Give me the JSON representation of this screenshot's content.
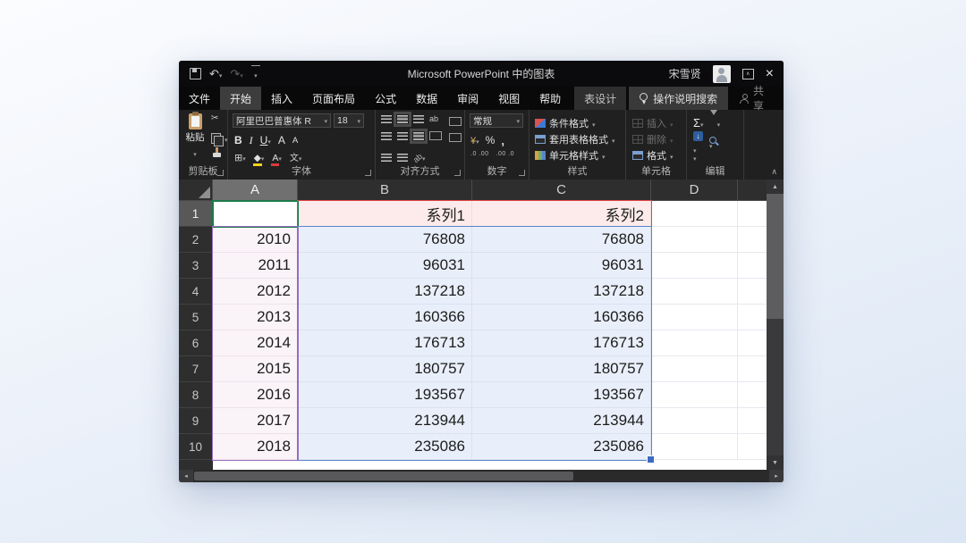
{
  "window": {
    "title": "Microsoft PowerPoint 中的图表",
    "user_name": "宋雪贤",
    "tabs": [
      "文件",
      "开始",
      "插入",
      "页面布局",
      "公式",
      "数据",
      "审阅",
      "视图",
      "帮助",
      "表设计"
    ],
    "active_tab": "开始",
    "search_label": "操作说明搜索",
    "share_label": "共享"
  },
  "icons": {
    "undo": "↶",
    "redo": "↷",
    "close": "×",
    "restore": "∧",
    "scissors": "✂",
    "borders": "⊞",
    "fill_arrow": "↓"
  },
  "ribbon": {
    "groups": {
      "clipboard": "剪贴板",
      "font": "字体",
      "alignment": "对齐方式",
      "number": "数字",
      "styles": "样式",
      "cells": "单元格",
      "editing": "编辑"
    },
    "clipboard": {
      "paste": "粘贴"
    },
    "font": {
      "name": "阿里巴巴普惠体 R",
      "size": "18",
      "bold": "B",
      "italic": "I",
      "underline": "U",
      "grow": "A",
      "shrink": "A",
      "phonetic": "文"
    },
    "alignment": {
      "orientation": "ab",
      "direction": "ab"
    },
    "number": {
      "format": "常规",
      "currency": "¥",
      "percent": "%",
      "comma": ",",
      "inc_decimal": ".0 .00",
      "dec_decimal": ".00 .0"
    },
    "styles": {
      "conditional": "条件格式",
      "format_table": "套用表格格式",
      "cell_styles": "单元格样式"
    },
    "cells": {
      "insert": "插入",
      "delete": "删除",
      "format": "格式"
    },
    "editing": {
      "autosum": "Σ"
    }
  },
  "sheet": {
    "col_headers": [
      "A",
      "B",
      "C",
      "D"
    ],
    "rows": [
      {
        "num": "1",
        "a": "",
        "b": "系列1",
        "c": "系列2"
      },
      {
        "num": "2",
        "a": "2010",
        "b": "76808",
        "c": "76808"
      },
      {
        "num": "3",
        "a": "2011",
        "b": "96031",
        "c": "96031"
      },
      {
        "num": "4",
        "a": "2012",
        "b": "137218",
        "c": "137218"
      },
      {
        "num": "5",
        "a": "2013",
        "b": "160366",
        "c": "160366"
      },
      {
        "num": "6",
        "a": "2014",
        "b": "176713",
        "c": "176713"
      },
      {
        "num": "7",
        "a": "2015",
        "b": "180757",
        "c": "180757"
      },
      {
        "num": "8",
        "a": "2016",
        "b": "193567",
        "c": "193567"
      },
      {
        "num": "9",
        "a": "2017",
        "b": "213944",
        "c": "213944"
      },
      {
        "num": "10",
        "a": "2018",
        "b": "235086",
        "c": "235086"
      }
    ]
  },
  "colors": {
    "selection_green": "#1c7a4a",
    "series_range_red": "#e04545",
    "category_range_purple": "#9a6fc0",
    "value_range_blue": "#5b84c8",
    "fill_yellow": "#f3d11c",
    "font_red": "#d83b3b"
  }
}
